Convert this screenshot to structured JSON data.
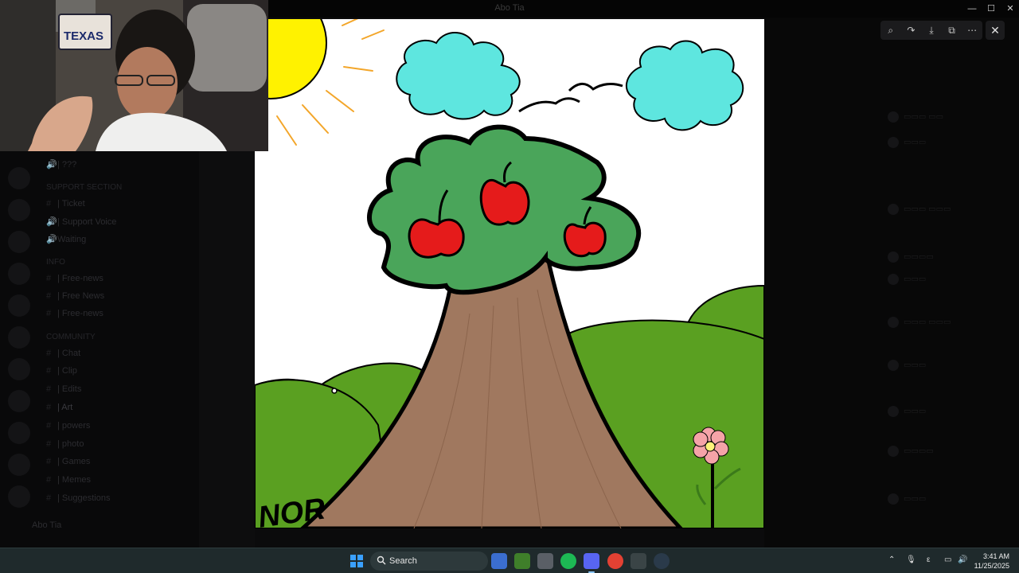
{
  "window": {
    "title": "Abo Tia"
  },
  "webcam": {
    "sign_text": "TEXAS"
  },
  "sidebar": {
    "channels": [
      {
        "label": "| ???",
        "kind": "voice"
      },
      {
        "label": "SUPPORT SECTION",
        "kind": "category"
      },
      {
        "label": "| Ticket",
        "kind": "text"
      },
      {
        "label": "| Support Voice",
        "kind": "voice"
      },
      {
        "label": "Waiting",
        "kind": "voice"
      },
      {
        "label": "INFO",
        "kind": "category"
      },
      {
        "label": "| Free-news",
        "kind": "text"
      },
      {
        "label": "| Free News",
        "kind": "text"
      },
      {
        "label": "| Free-news",
        "kind": "text"
      },
      {
        "label": "COMMUNITY",
        "kind": "category"
      },
      {
        "label": "| Chat",
        "kind": "text"
      },
      {
        "label": "| Clip",
        "kind": "text"
      },
      {
        "label": "| Edits",
        "kind": "text"
      },
      {
        "label": "| Art",
        "kind": "text"
      },
      {
        "label": "| powers",
        "kind": "text"
      },
      {
        "label": "| photo",
        "kind": "text"
      },
      {
        "label": "| Games",
        "kind": "text"
      },
      {
        "label": "| Memes",
        "kind": "text"
      },
      {
        "label": "| Suggestions",
        "kind": "text"
      }
    ],
    "user_name": "Abo Tia"
  },
  "viewer": {
    "signature": "NOR",
    "tools": [
      "zoom-icon",
      "redo-icon",
      "download-icon",
      "open-external-icon",
      "more-icon"
    ],
    "close_icon": "close-icon"
  },
  "taskbar": {
    "search_placeholder": "Search",
    "time": "3:41 AM",
    "date": "11/25/2025",
    "apps": [
      "file-explorer-icon",
      "minecraft-icon",
      "app-icon",
      "spotify-icon",
      "discord-icon",
      "chrome-icon",
      "xbox-icon",
      "steam-icon"
    ],
    "colors": {
      "accent": "#3aa0ff",
      "taskbar": "#1f2a2c"
    }
  }
}
